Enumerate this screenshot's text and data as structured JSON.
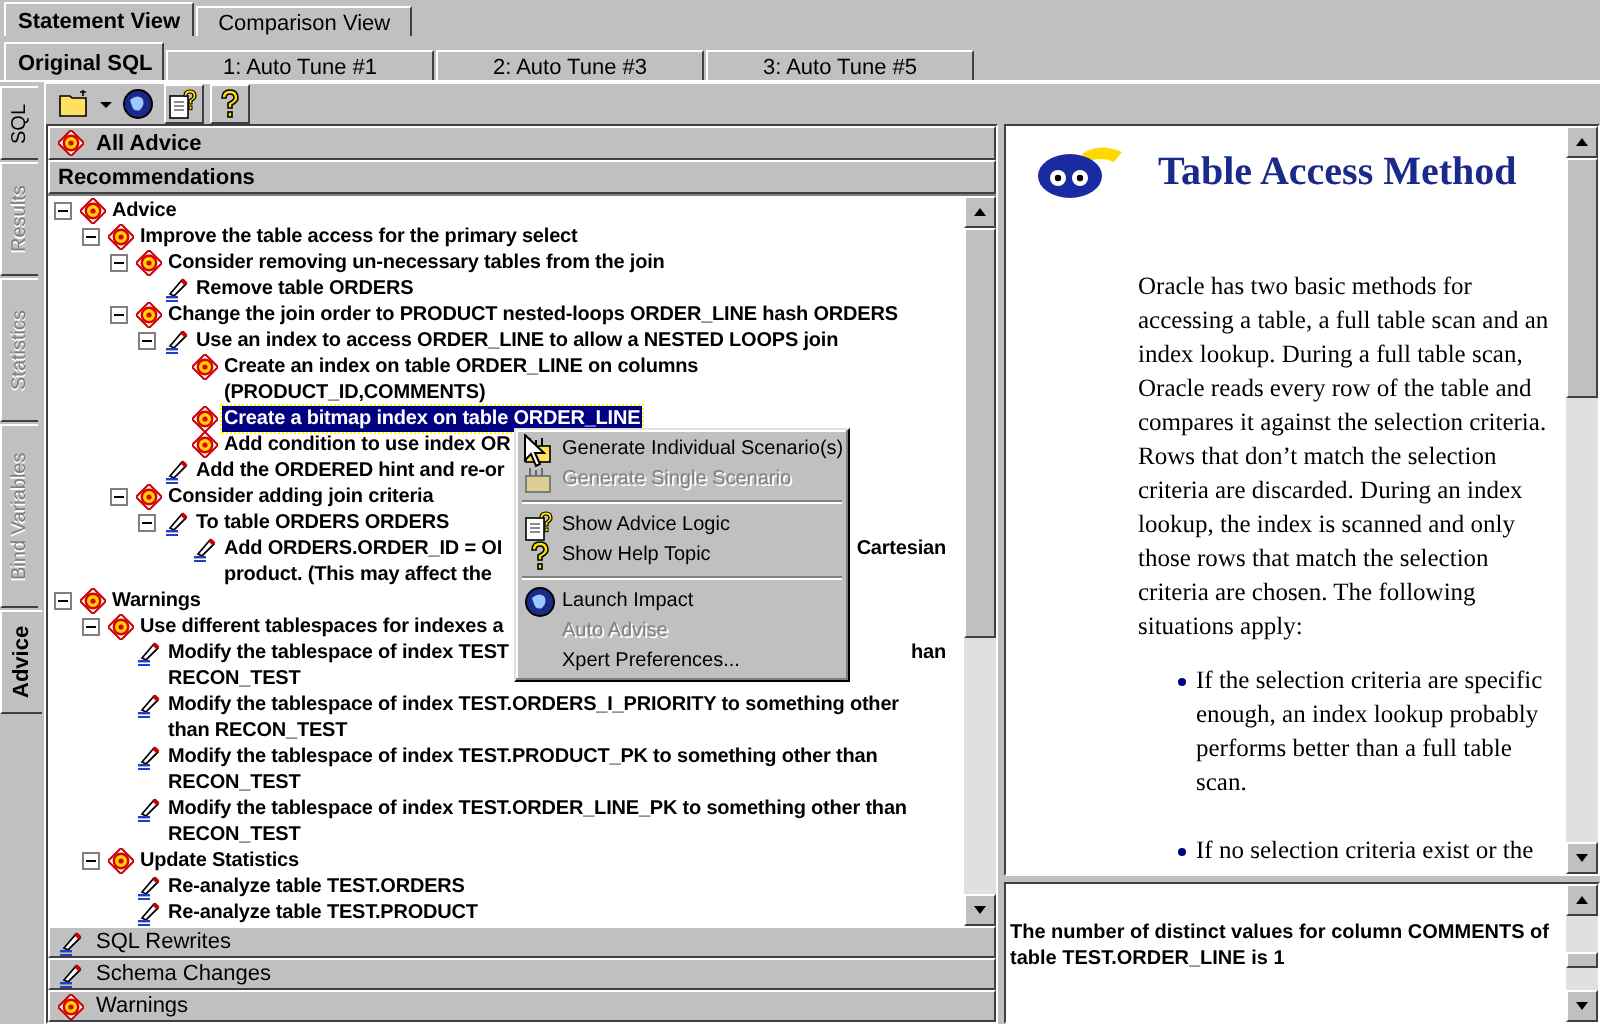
{
  "view_tabs": [
    {
      "label": "Statement View",
      "selected": true
    },
    {
      "label": "Comparison View",
      "selected": false
    }
  ],
  "scenario_tabs": [
    {
      "label": "Original SQL",
      "selected": true
    },
    {
      "label": "1: Auto Tune #1",
      "selected": false
    },
    {
      "label": "2: Auto Tune #3",
      "selected": false
    },
    {
      "label": "3: Auto Tune #5",
      "selected": false
    }
  ],
  "side_tabs": [
    {
      "label": "SQL",
      "selected": false,
      "disabled": false
    },
    {
      "label": "Results",
      "selected": false,
      "disabled": true
    },
    {
      "label": "Statistics",
      "selected": false,
      "disabled": true
    },
    {
      "label": "Bind Variables",
      "selected": false,
      "disabled": true
    },
    {
      "label": "Advice",
      "selected": true,
      "disabled": false
    }
  ],
  "toolbar": [
    {
      "kind": "folder"
    },
    {
      "kind": "dropdown"
    },
    {
      "kind": "globe"
    },
    {
      "kind": "doc-help"
    },
    {
      "kind": "help"
    }
  ],
  "advice_panel": {
    "header": "All Advice",
    "section": "Recommendations",
    "tree": [
      {
        "kind": "advice",
        "lines": [
          "Advice"
        ],
        "selected": false,
        "expanded": true,
        "children": [
          {
            "kind": "advice",
            "lines": [
              "Improve the table access for the primary select"
            ],
            "selected": false,
            "expanded": true,
            "children": [
              {
                "kind": "advice",
                "lines": [
                  "Consider removing un-necessary tables from the join"
                ],
                "selected": false,
                "expanded": true,
                "children": [
                  {
                    "kind": "action",
                    "lines": [
                      "Remove table ORDERS"
                    ],
                    "selected": false
                  }
                ]
              },
              {
                "kind": "advice",
                "lines": [
                  "Change the join order to PRODUCT nested-loops ORDER_LINE hash ORDERS"
                ],
                "selected": false,
                "expanded": true,
                "children": [
                  {
                    "kind": "action",
                    "lines": [
                      "Use an index to access ORDER_LINE to allow a NESTED LOOPS join"
                    ],
                    "selected": false,
                    "expanded": true,
                    "children": [
                      {
                        "kind": "advice",
                        "lines": [
                          "Create an index on table ORDER_LINE on columns",
                          "(PRODUCT_ID,COMMENTS)"
                        ],
                        "selected": false
                      },
                      {
                        "kind": "advice",
                        "lines": [
                          "Create a bitmap index on table ORDER_LINE"
                        ],
                        "selected": true
                      },
                      {
                        "kind": "advice",
                        "lines": [
                          "Add condition to use index OR"
                        ],
                        "selected": false
                      }
                    ]
                  },
                  {
                    "kind": "action",
                    "lines": [
                      "Add the ORDERED hint and re-or"
                    ],
                    "selected": false
                  }
                ]
              },
              {
                "kind": "advice",
                "lines": [
                  "Consider adding join criteria"
                ],
                "selected": false,
                "expanded": true,
                "children": [
                  {
                    "kind": "action",
                    "lines": [
                      "To table ORDERS ORDERS"
                    ],
                    "selected": false,
                    "expanded": true,
                    "children": [
                      {
                        "kind": "action",
                        "lines": [
                          "Add ORDERS.ORDER_ID = OI",
                          "product.  (This may affect the"
                        ],
                        "right": "Cartesian",
                        "selected": false
                      }
                    ]
                  }
                ]
              }
            ]
          }
        ]
      },
      {
        "kind": "advice",
        "lines": [
          "Warnings"
        ],
        "selected": false,
        "expanded": true,
        "children": [
          {
            "kind": "advice",
            "lines": [
              "Use different tablespaces for indexes a"
            ],
            "selected": false,
            "expanded": true,
            "children": [
              {
                "kind": "action",
                "lines": [
                  "Modify the tablespace of index TEST",
                  "RECON_TEST"
                ],
                "right": "han",
                "selected": false
              },
              {
                "kind": "action",
                "lines": [
                  "Modify the tablespace of index TEST.ORDERS_I_PRIORITY to something other",
                  "than RECON_TEST"
                ],
                "selected": false
              },
              {
                "kind": "action",
                "lines": [
                  "Modify the tablespace of index TEST.PRODUCT_PK to something other than",
                  "RECON_TEST"
                ],
                "selected": false
              },
              {
                "kind": "action",
                "lines": [
                  "Modify the tablespace of index TEST.ORDER_LINE_PK to something other than",
                  "RECON_TEST"
                ],
                "selected": false
              }
            ]
          },
          {
            "kind": "advice",
            "lines": [
              "Update Statistics"
            ],
            "selected": false,
            "expanded": true,
            "children": [
              {
                "kind": "action",
                "lines": [
                  "Re-analyze table TEST.ORDERS"
                ],
                "selected": false
              },
              {
                "kind": "action",
                "lines": [
                  "Re-analyze table TEST.PRODUCT"
                ],
                "selected": false
              }
            ]
          }
        ]
      }
    ],
    "footer_sections": [
      {
        "kind": "action",
        "label": "SQL Rewrites"
      },
      {
        "kind": "action",
        "label": "Schema Changes"
      },
      {
        "kind": "advice",
        "label": "Warnings"
      }
    ]
  },
  "help": {
    "title": "Table Access Method",
    "paragraph": "Oracle has two basic methods for accessing a table, a full table scan and an index lookup. During a full table scan, Oracle reads every row of the table and compares it against the selection criteria. Rows that don’t match the selection criteria are discarded. During an index lookup, the index is scanned and only those rows that match the selection criteria are chosen. The following situations apply:",
    "bullets": [
      "If the selection criteria are specific enough, an index lookup probably performs better than a full table scan.",
      "If no selection criteria exist or the"
    ]
  },
  "details": {
    "text": "The number of distinct values for column COMMENTS of table TEST.ORDER_LINE is 1"
  },
  "context_menu": [
    {
      "kind": "item",
      "label": "Generate Individual Scenario(s)",
      "disabled": false
    },
    {
      "kind": "item",
      "label": "Generate Single Scenario",
      "disabled": true
    },
    {
      "kind": "separator"
    },
    {
      "kind": "item",
      "label": "Show Advice Logic",
      "disabled": false
    },
    {
      "kind": "item",
      "label": "Show Help Topic",
      "disabled": false
    },
    {
      "kind": "separator"
    },
    {
      "kind": "item",
      "label": "Launch Impact",
      "disabled": false
    },
    {
      "kind": "item",
      "label": "Auto Advise",
      "disabled": true
    },
    {
      "kind": "item",
      "label": "Xpert Preferences...",
      "disabled": false
    }
  ]
}
